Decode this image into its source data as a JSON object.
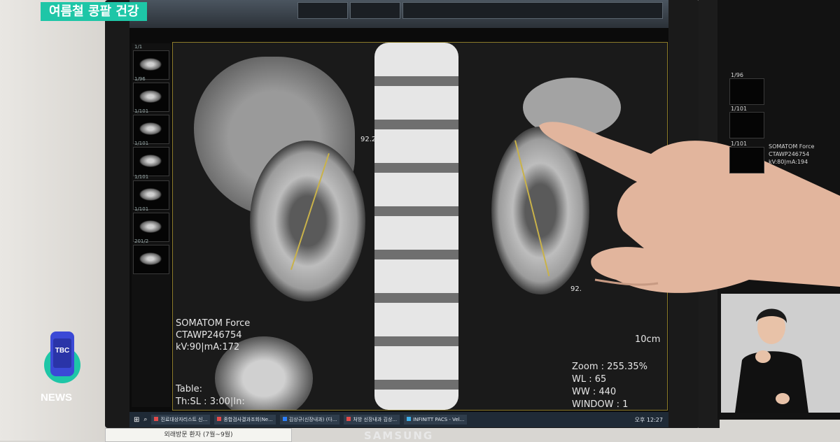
{
  "headline": "여름철 콩팥 건강",
  "broadcaster": {
    "name": "TBC",
    "tag": "NEWS"
  },
  "ct": {
    "scanner_line1": "SOMATOM Force",
    "scanner_line2": "CTAWP246754",
    "scanner_line3": "kV:90|mA:172",
    "table_line1": "Table:",
    "table_line2": "Th:SL : 3:00|In:",
    "scale": "10cm",
    "zoom": "Zoom : 255.35%",
    "wl": "WL : 65",
    "ww": "WW : 440",
    "window": "WINDOW : 1",
    "measure_left": "92.21",
    "measure_right": "92."
  },
  "left_series": [
    {
      "label": "1/1"
    },
    {
      "label": "1/96"
    },
    {
      "label": "1/101"
    },
    {
      "label": "1/101"
    },
    {
      "label": "1/101"
    },
    {
      "label": "1/101"
    },
    {
      "label": "201/2"
    }
  ],
  "taskbar": {
    "items": [
      {
        "label": "진료대상자리스트 신...",
        "color": "#e24b4b"
      },
      {
        "label": "종합검사결과조회(Ne...",
        "color": "#e24b4b"
      },
      {
        "label": "김상규(신장내과) (다...",
        "color": "#2d7ff9"
      },
      {
        "label": "처방 신장내과 김상...",
        "color": "#e24b4b"
      },
      {
        "label": "INFINITT PACS - Vel...",
        "color": "#3fb0e8"
      }
    ],
    "clock": "오후 12:27"
  },
  "right_monitor": {
    "series": [
      {
        "label": "1/96"
      },
      {
        "label": "1/101"
      },
      {
        "label": "1/101"
      }
    ],
    "scanner_line1": "SOMATOM Force",
    "scanner_line2": "CTAWP246754",
    "scanner_line3": "kV:80|mA:194"
  },
  "monitor_brand": "SAMSUNG",
  "paper_note": "외래방문 환자 (7월~9월)"
}
